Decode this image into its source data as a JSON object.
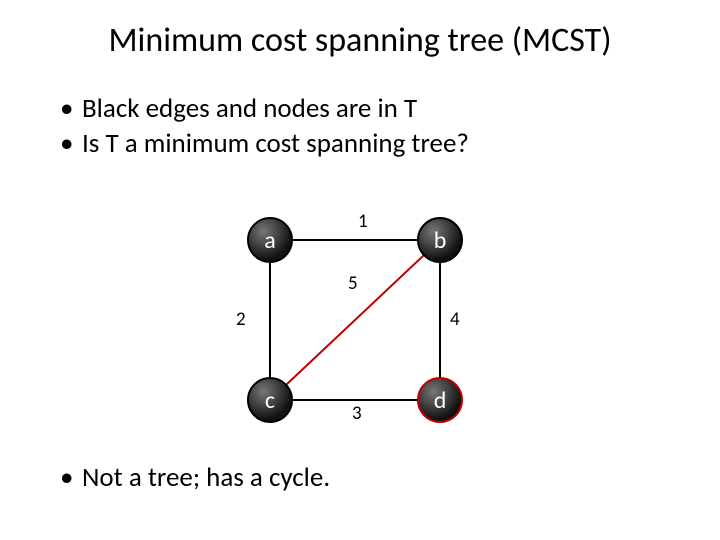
{
  "title": "Minimum cost spanning tree (MCST)",
  "bullets_top": {
    "b0": "Black edges and nodes are in T",
    "b1": "Is T a minimum cost spanning tree?"
  },
  "bullets_bottom": {
    "b0": "Not a tree; has a cycle."
  },
  "graph": {
    "nodes": {
      "a": "a",
      "b": "b",
      "c": "c",
      "d": "d"
    },
    "weights": {
      "ab": "1",
      "ac": "2",
      "cd": "3",
      "bd": "4",
      "cb": "5"
    }
  }
}
